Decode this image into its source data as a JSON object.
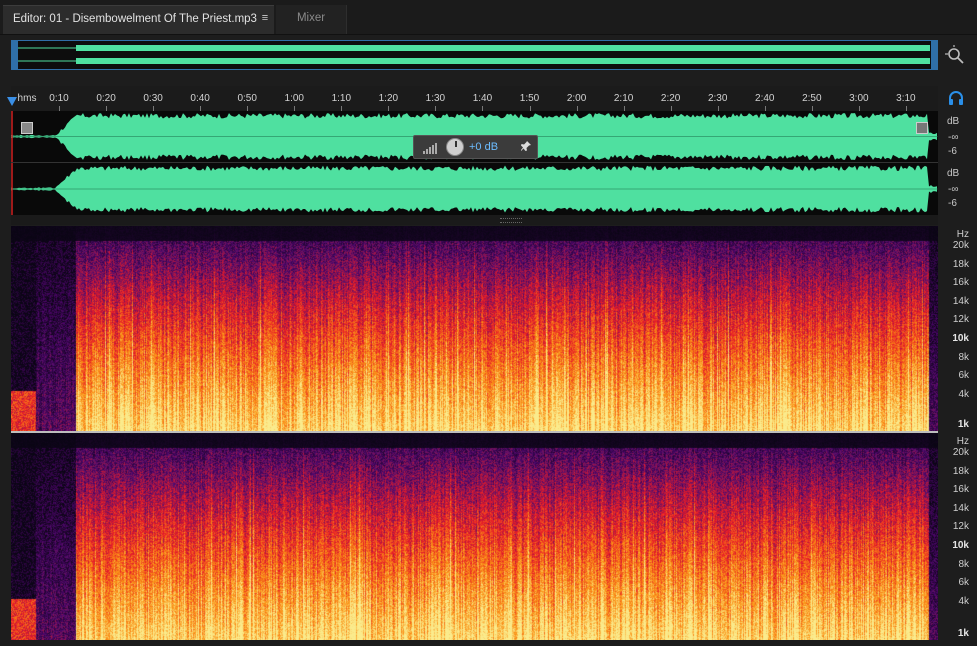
{
  "tabs": {
    "editor_label": "Editor: 01 - Disembowelment Of The Priest.mp3",
    "menu_glyph": "≡",
    "mixer_label": "Mixer"
  },
  "ruler": {
    "unit": "hms",
    "ticks": [
      "0:10",
      "0:20",
      "0:30",
      "0:40",
      "0:50",
      "1:00",
      "1:10",
      "1:20",
      "1:30",
      "1:40",
      "1:50",
      "2:00",
      "2:10",
      "2:20",
      "2:30",
      "2:40",
      "2:50",
      "3:00",
      "3:10"
    ]
  },
  "waveform": {
    "color": "#4fe0a0",
    "db_top_label": "dB",
    "db_inf_label": "-∞",
    "db_six_label": "-6"
  },
  "hud": {
    "gain_value": "+0 dB",
    "pin_glyph": "📌"
  },
  "spectral": {
    "hz_unit": "Hz",
    "freq_labels": [
      "20k",
      "18k",
      "16k",
      "14k",
      "12k",
      "10k",
      "8k",
      "6k",
      "4k",
      "1k"
    ]
  },
  "icons": {
    "zoom": "zoom-icon",
    "headphones": "headphones-icon"
  },
  "colors": {
    "accent": "#3a8fe6",
    "waveform": "#4fe0a0",
    "spectral_low": "#ffd070",
    "spectral_mid": "#e8301e",
    "spectral_high": "#4b1a7a"
  }
}
